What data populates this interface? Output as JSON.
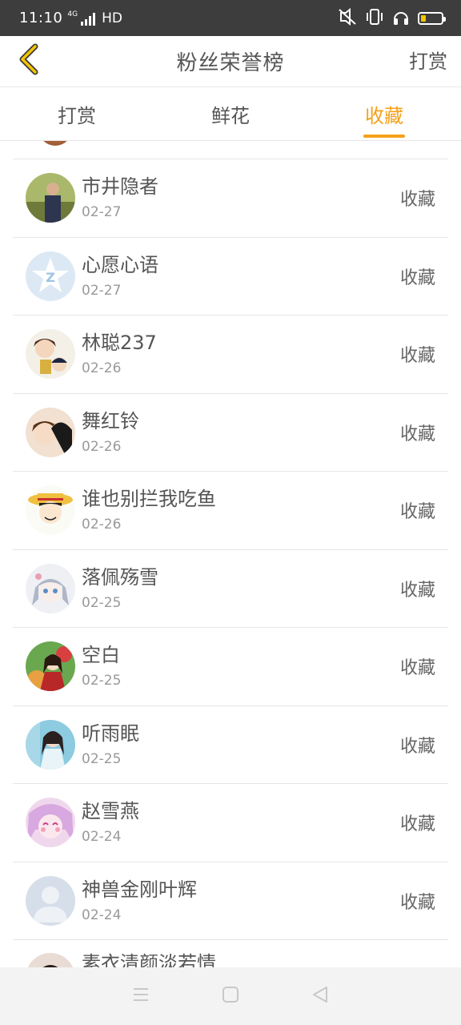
{
  "status_bar": {
    "time": "11:10",
    "network_label": "4G",
    "hd_label": "HD",
    "battery_level": 0.25,
    "battery_color": "#f2c500"
  },
  "header": {
    "title": "粉丝荣誉榜",
    "action_label": "打赏",
    "back_icon": "chevron-left-icon",
    "accent_color": "#f5c400"
  },
  "tabs": [
    {
      "label": "打赏",
      "active": false
    },
    {
      "label": "鲜花",
      "active": false
    },
    {
      "label": "收藏",
      "active": true
    }
  ],
  "active_color": "#f5a11a",
  "fans": [
    {
      "name": "市井隐者",
      "date": "02-27",
      "action": "收藏"
    },
    {
      "name": "心愿心语",
      "date": "02-27",
      "action": "收藏"
    },
    {
      "name": "林聪237",
      "date": "02-26",
      "action": "收藏"
    },
    {
      "name": "舞红铃",
      "date": "02-26",
      "action": "收藏"
    },
    {
      "name": "谁也别拦我吃鱼",
      "date": "02-26",
      "action": "收藏"
    },
    {
      "name": "落佩殇雪",
      "date": "02-25",
      "action": "收藏"
    },
    {
      "name": "空白",
      "date": "02-25",
      "action": "收藏"
    },
    {
      "name": "听雨眠",
      "date": "02-25",
      "action": "收藏"
    },
    {
      "name": "赵雪燕",
      "date": "02-24",
      "action": "收藏"
    },
    {
      "name": "神兽金刚叶辉",
      "date": "02-24",
      "action": "收藏"
    }
  ],
  "partial_fan": {
    "name": "素衣清颜淡若情"
  },
  "nav": {
    "menu_icon": "menu-icon",
    "home_icon": "home-square-icon",
    "back_icon": "back-triangle-icon"
  }
}
